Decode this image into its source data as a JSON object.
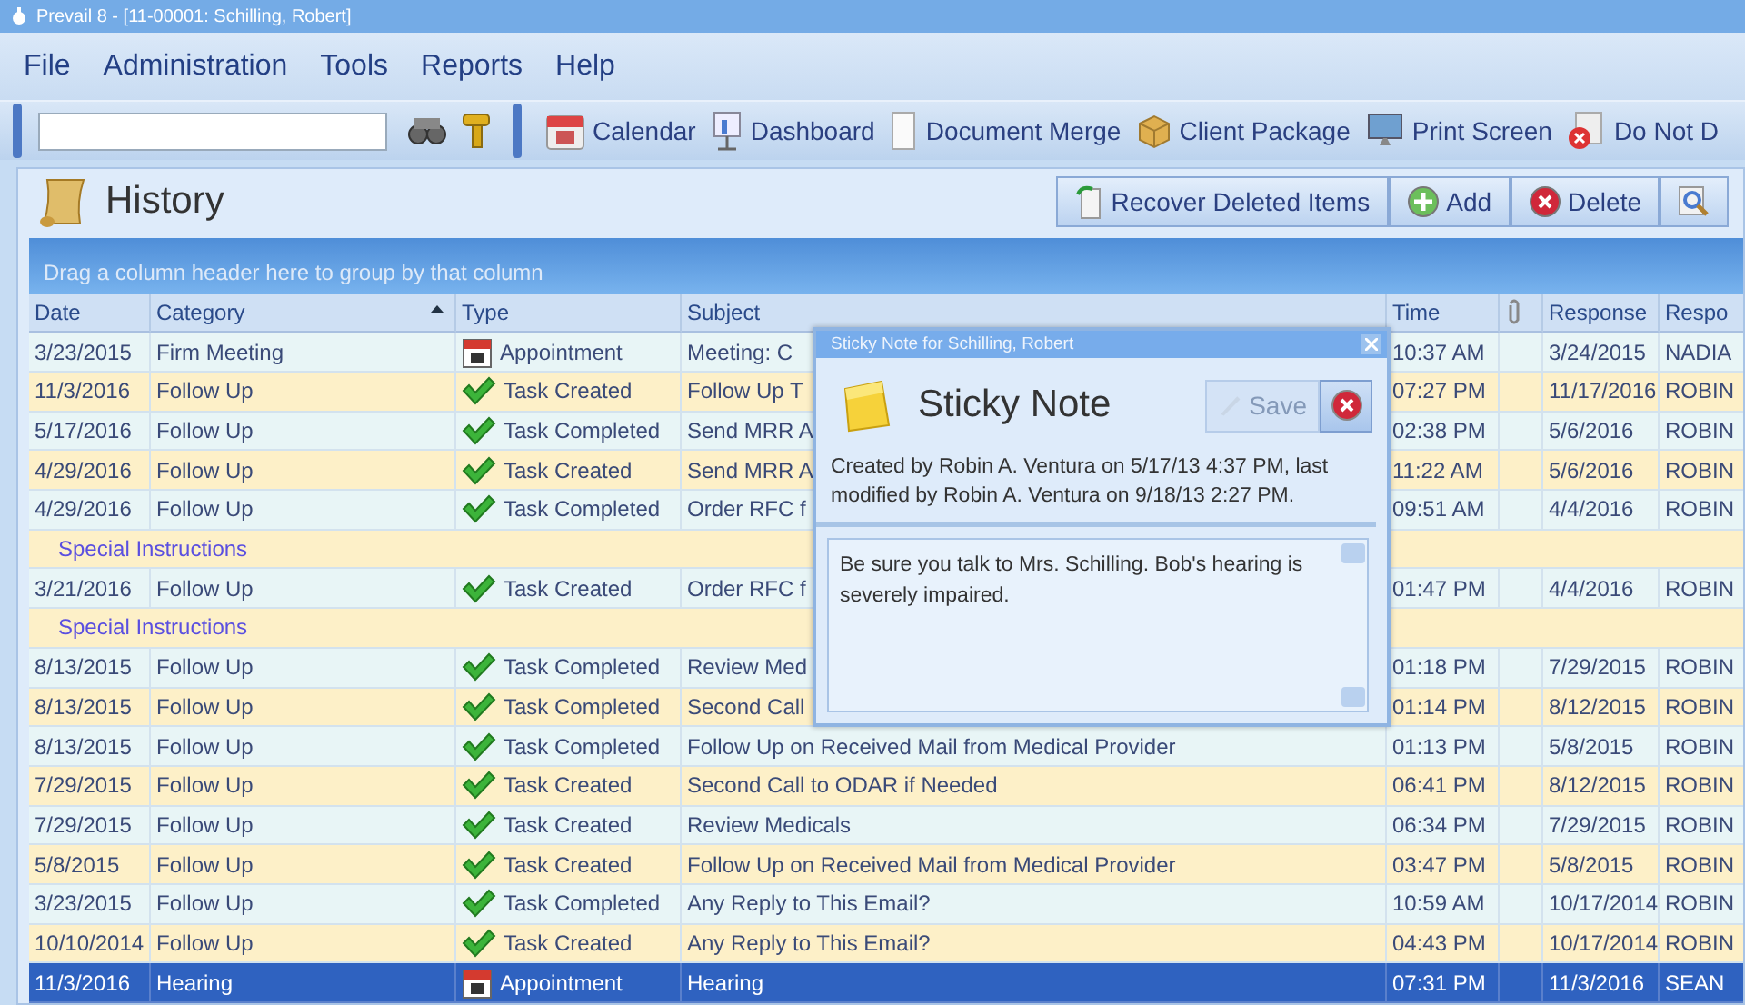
{
  "window": {
    "title": "Prevail 8 - [11-00001: Schilling, Robert]"
  },
  "menu": [
    "File",
    "Administration",
    "Tools",
    "Reports",
    "Help"
  ],
  "toolbar": {
    "buttons": [
      {
        "kind": "calendar",
        "label": "Calendar"
      },
      {
        "kind": "dashboard",
        "label": "Dashboard"
      },
      {
        "kind": "document",
        "label": "Document Merge"
      },
      {
        "kind": "package",
        "label": "Client Package"
      },
      {
        "kind": "monitor",
        "label": "Print Screen"
      },
      {
        "kind": "blocked",
        "label": "Do Not D"
      }
    ]
  },
  "panel": {
    "title": "History",
    "actions": [
      {
        "kind": "recover",
        "label": "Recover Deleted Items"
      },
      {
        "kind": "add",
        "label": "Add"
      },
      {
        "kind": "delete",
        "label": "Delete"
      },
      {
        "kind": "search"
      }
    ],
    "group_hint": "Drag a column header here to group by that column"
  },
  "table": {
    "columns": [
      {
        "kind": "text",
        "label": "Date",
        "sorted": false
      },
      {
        "kind": "text",
        "label": "Category",
        "sorted": true
      },
      {
        "kind": "text",
        "label": "Type",
        "sorted": false
      },
      {
        "kind": "text",
        "label": "Subject",
        "sorted": false
      },
      {
        "kind": "text",
        "label": "Time",
        "sorted": false
      },
      {
        "kind": "attachment",
        "sorted": false
      },
      {
        "kind": "text",
        "label": "Response",
        "sorted": false
      },
      {
        "kind": "text",
        "label": "Respo",
        "sorted": false
      }
    ],
    "rows": [
      {
        "kind": "entry",
        "selected": false,
        "date": "3/23/2015",
        "category": "Firm Meeting",
        "type": {
          "kind": "appointment",
          "label": "Appointment"
        },
        "subject": "Meeting:  C",
        "time": "10:37 AM",
        "response": "3/24/2015",
        "responder": "NADIA"
      },
      {
        "kind": "entry",
        "selected": false,
        "date": "11/3/2016",
        "category": "Follow Up",
        "type": {
          "kind": "task",
          "label": "Task Created"
        },
        "subject": "Follow Up T",
        "time": "07:27 PM",
        "response": "11/17/2016",
        "responder": "ROBIN"
      },
      {
        "kind": "entry",
        "selected": false,
        "date": "5/17/2016",
        "category": "Follow Up",
        "type": {
          "kind": "task",
          "label": "Task Completed"
        },
        "subject": "Send MRR A",
        "time": "02:38 PM",
        "response": "5/6/2016",
        "responder": "ROBIN"
      },
      {
        "kind": "entry",
        "selected": false,
        "date": "4/29/2016",
        "category": "Follow Up",
        "type": {
          "kind": "task",
          "label": "Task Created"
        },
        "subject": "Send MRR A",
        "time": "11:22 AM",
        "response": "5/6/2016",
        "responder": "ROBIN"
      },
      {
        "kind": "entry",
        "selected": false,
        "date": "4/29/2016",
        "category": "Follow Up",
        "type": {
          "kind": "task",
          "label": "Task Completed"
        },
        "subject": "Order RFC f",
        "time": "09:51 AM",
        "response": "4/4/2016",
        "responder": "ROBIN"
      },
      {
        "kind": "note",
        "selected": false,
        "text": "Special Instructions"
      },
      {
        "kind": "entry",
        "selected": false,
        "date": "3/21/2016",
        "category": "Follow Up",
        "type": {
          "kind": "task",
          "label": "Task Created"
        },
        "subject": "Order RFC f",
        "time": "01:47 PM",
        "response": "4/4/2016",
        "responder": "ROBIN"
      },
      {
        "kind": "note",
        "selected": false,
        "text": "Special Instructions"
      },
      {
        "kind": "entry",
        "selected": false,
        "date": "8/13/2015",
        "category": "Follow Up",
        "type": {
          "kind": "task",
          "label": "Task Completed"
        },
        "subject": "Review Med",
        "time": "01:18 PM",
        "response": "7/29/2015",
        "responder": "ROBIN"
      },
      {
        "kind": "entry",
        "selected": false,
        "date": "8/13/2015",
        "category": "Follow Up",
        "type": {
          "kind": "task",
          "label": "Task Completed"
        },
        "subject": "Second Call",
        "time": "01:14 PM",
        "response": "8/12/2015",
        "responder": "ROBIN"
      },
      {
        "kind": "entry",
        "selected": false,
        "date": "8/13/2015",
        "category": "Follow Up",
        "type": {
          "kind": "task",
          "label": "Task Completed"
        },
        "subject": "Follow Up on Received Mail from Medical Provider",
        "time": "01:13 PM",
        "response": "5/8/2015",
        "responder": "ROBIN"
      },
      {
        "kind": "entry",
        "selected": false,
        "date": "7/29/2015",
        "category": "Follow Up",
        "type": {
          "kind": "task",
          "label": "Task Created"
        },
        "subject": "Second Call to ODAR if Needed",
        "time": "06:41 PM",
        "response": "8/12/2015",
        "responder": "ROBIN"
      },
      {
        "kind": "entry",
        "selected": false,
        "date": "7/29/2015",
        "category": "Follow Up",
        "type": {
          "kind": "task",
          "label": "Task Created"
        },
        "subject": "Review Medicals",
        "time": "06:34 PM",
        "response": "7/29/2015",
        "responder": "ROBIN"
      },
      {
        "kind": "entry",
        "selected": false,
        "date": "5/8/2015",
        "category": "Follow Up",
        "type": {
          "kind": "task",
          "label": "Task Created"
        },
        "subject": "Follow Up on Received Mail from Medical Provider",
        "time": "03:47 PM",
        "response": "5/8/2015",
        "responder": "ROBIN"
      },
      {
        "kind": "entry",
        "selected": false,
        "date": "3/23/2015",
        "category": "Follow Up",
        "type": {
          "kind": "task",
          "label": "Task Completed"
        },
        "subject": "Any Reply to This Email?",
        "time": "10:59 AM",
        "response": "10/17/2014",
        "responder": "ROBIN"
      },
      {
        "kind": "entry",
        "selected": false,
        "date": "10/10/2014",
        "category": "Follow Up",
        "type": {
          "kind": "task",
          "label": "Task Created"
        },
        "subject": "Any Reply to This Email?",
        "time": "04:43 PM",
        "response": "10/17/2014",
        "responder": "ROBIN"
      },
      {
        "kind": "entry",
        "selected": true,
        "date": "11/3/2016",
        "category": "Hearing",
        "type": {
          "kind": "appointment",
          "label": "Appointment"
        },
        "subject": "Hearing",
        "time": "07:31 PM",
        "response": "11/3/2016",
        "responder": "SEAN"
      }
    ]
  },
  "sticky_note": {
    "window_title": "Sticky Note for Schilling, Robert",
    "heading": "Sticky Note",
    "save": {
      "label": "Save",
      "disabled": true
    },
    "info": "Created by Robin A. Ventura on 5/17/13 4:37 PM, last modified by Robin A. Ventura on 9/18/13 2:27 PM.",
    "note": "Be sure you talk to Mrs. Schilling.  Bob's hearing is severely impaired."
  }
}
